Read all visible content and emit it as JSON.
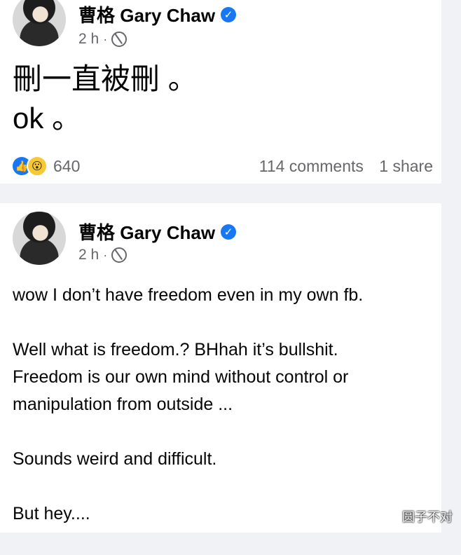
{
  "post1": {
    "author": "曹格 Gary Chaw",
    "time": "2 h",
    "text": [
      "刪一直被刪 。",
      "ok 。"
    ],
    "reaction_count": "640",
    "comments": "114 comments",
    "shares": "1 share",
    "icons": {
      "verified": "verified-check-icon",
      "audience": "globe-icon",
      "like": "like-reaction-icon",
      "wow": "wow-reaction-icon"
    }
  },
  "post2": {
    "author": "曹格 Gary Chaw",
    "time": "2 h",
    "paragraphs": [
      "wow I don’t have freedom even in my own fb.",
      "Well what is freedom.? BHhah it’s bullshit.\nFreedom is our own mind without control or\nmanipulation from outside ...",
      "Sounds weird and difficult.",
      "But hey...."
    ]
  },
  "watermark": "圆子不对",
  "colors": {
    "background": "#f0f2f5",
    "card": "#ffffff",
    "brand": "#1877f2",
    "meta": "#65676b"
  }
}
